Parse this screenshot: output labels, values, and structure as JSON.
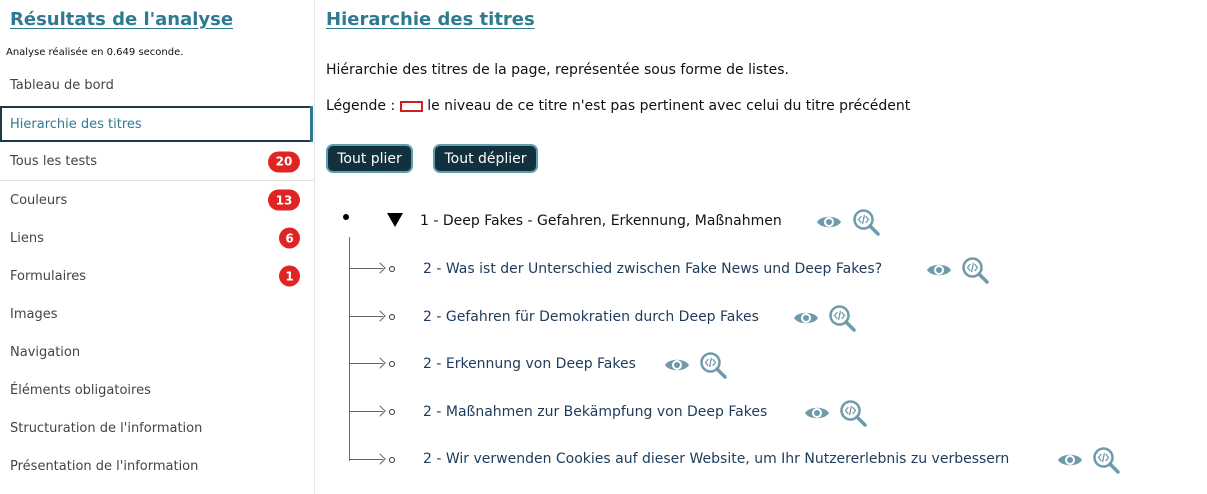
{
  "sidebar": {
    "title": "Résultats de l'analyse",
    "analysis_time": "Analyse réalisée en 0.649 seconde.",
    "items": [
      {
        "label": "Tableau de bord"
      },
      {
        "label": "Hierarchie des titres"
      },
      {
        "label": "Tous les tests",
        "badge": "20"
      },
      {
        "label": "Couleurs",
        "badge": "13"
      },
      {
        "label": "Liens",
        "badge": "6"
      },
      {
        "label": "Formulaires",
        "badge": "1"
      },
      {
        "label": "Images"
      },
      {
        "label": "Navigation"
      },
      {
        "label": "Éléments obligatoires"
      },
      {
        "label": "Structuration de l'information"
      },
      {
        "label": "Présentation de l'information"
      }
    ]
  },
  "main": {
    "title": "Hierarchie des titres",
    "description": "Hiérarchie des titres de la page, représentée sous forme de listes.",
    "legend_prefix": "Légende :",
    "legend_text": "le niveau de ce titre n'est pas pertinent avec celui du titre précédent",
    "collapse_label": "Tout plier",
    "expand_label": "Tout déplier",
    "tree": {
      "h1": "1 - Deep Fakes - Gefahren, Erkennung, Maßnahmen",
      "children": [
        "2 - Was ist der Unterschied zwischen Fake News und Deep Fakes?",
        "2 - Gefahren für Demokratien durch Deep Fakes",
        "2 - Erkennung von Deep Fakes",
        "2 - Maßnahmen zur Bekämpfung von Deep Fakes",
        "2 - Wir verwenden Cookies auf dieser Website, um Ihr Nutzererlebnis zu verbessern"
      ]
    }
  },
  "colors": {
    "accent": "#2f7a91",
    "badge": "#e02424",
    "button_bg": "#12313d",
    "icon": "#6f9aab"
  },
  "icons": [
    "eye-icon",
    "code-search-icon"
  ]
}
